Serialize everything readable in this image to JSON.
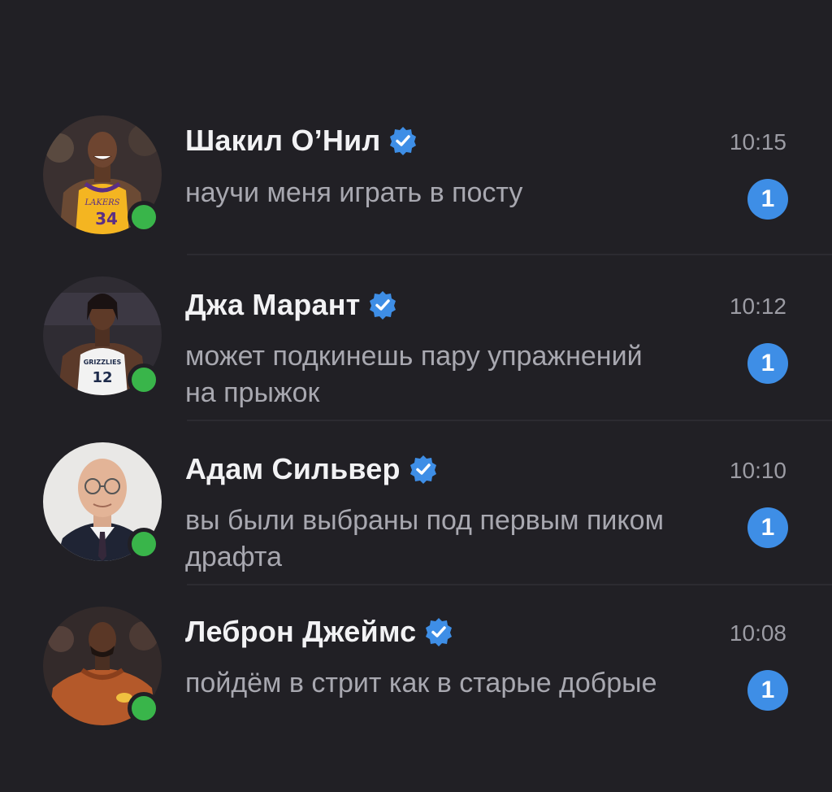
{
  "chats": [
    {
      "name": "Шакил О’Нил",
      "time": "10:15",
      "preview": "научи меня играть в посту",
      "unread": "1",
      "online": true,
      "verified": true,
      "avatar_icon": "avatar-shaquille-icon",
      "jersey_text": "LAKERS",
      "jersey_number": "34"
    },
    {
      "name": "Джа Марант",
      "time": "10:12",
      "preview": "может подкинешь пару упражнений на прыжок",
      "unread": "1",
      "online": true,
      "verified": true,
      "avatar_icon": "avatar-ja-morant-icon",
      "jersey_text": "GRIZZLIES",
      "jersey_number": "12"
    },
    {
      "name": "Адам Сильвер",
      "time": "10:10",
      "preview": "вы были выбраны под первым пиком драфта",
      "unread": "1",
      "online": true,
      "verified": true,
      "avatar_icon": "avatar-adam-silver-icon"
    },
    {
      "name": "Леброн Джеймс",
      "time": "10:08",
      "preview": "пойдём в стрит как в старые добрые",
      "unread": "1",
      "online": true,
      "verified": true,
      "avatar_icon": "avatar-lebron-icon"
    }
  ],
  "colors": {
    "background": "#212025",
    "accent": "#3e8ee6",
    "online": "#39b54a",
    "name": "#f2f2f4",
    "preview": "#a8a8b0"
  }
}
